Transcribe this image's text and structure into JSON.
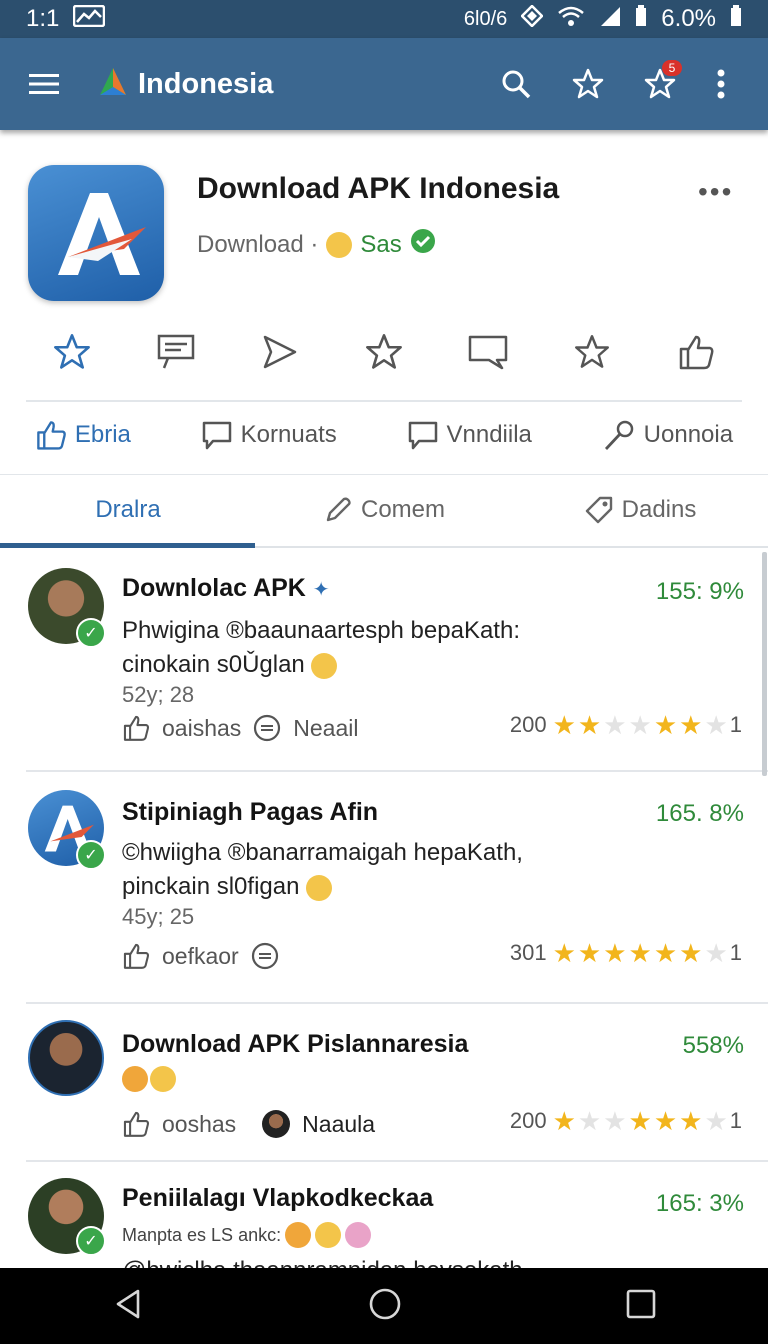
{
  "status": {
    "time": "1:1",
    "net": "6l0/6",
    "battery": "6.0%"
  },
  "appbar": {
    "title": "Indonesia",
    "badge": "5"
  },
  "app": {
    "title": "Download APK Indonesia",
    "sub_label": "Download ·",
    "author": "Sas",
    "more": "•••"
  },
  "actions": [
    {
      "label": "Ebria"
    },
    {
      "label": "Kornuats"
    },
    {
      "label": "Vnndiila"
    },
    {
      "label": "Uonnoia"
    }
  ],
  "tabs": [
    {
      "label": "Dralra"
    },
    {
      "label": "Comem"
    },
    {
      "label": "Dadins"
    }
  ],
  "items": [
    {
      "title": "Downlolac APK",
      "percent": "155: 9%",
      "desc_line1": "Phwigina ®baaunaartesph bepaKath:",
      "desc_line2": "cinokain s0Ǔglan",
      "meta": "52y; 28",
      "foot_a": "oaishas",
      "foot_b": "Neaail",
      "rating_count": "200",
      "rating_tail": "1",
      "stars": 2.5
    },
    {
      "title": "Stipiniagh Pagas Afin",
      "percent": "165. 8%",
      "desc_line1": "©hwiigha ®banarramaigah hepaKath,",
      "desc_line2": "pinckain sl0figan",
      "meta": "45y; 25",
      "foot_a": "oefkaor",
      "foot_b": "",
      "rating_count": "301",
      "rating_tail": "1",
      "stars": 4.5
    },
    {
      "title": "Download APK Pislannaresia",
      "percent": "558%",
      "foot_a": "ooshas",
      "foot_b": "Naaula",
      "rating_count": "200",
      "rating_tail": "1",
      "stars": 3
    },
    {
      "title": "Peniilalagı Vlapkodkeckaa",
      "percent": "165: 3%",
      "subline": "Manpta es LS ankc:",
      "desc_line1": "@hwiclha thaannramnidan hevsekath,"
    }
  ]
}
